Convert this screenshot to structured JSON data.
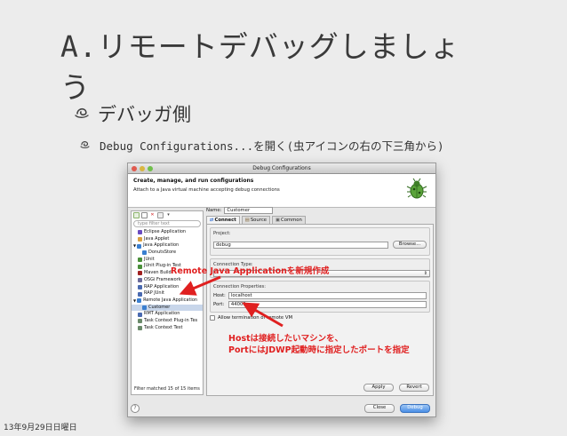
{
  "slide": {
    "title": "A.リモートデバッグしましょう",
    "bullet1": "デバッガ側",
    "bullet2": "Debug Configurations...を開く(虫アイコンの右の下三角から)",
    "date": "13年9月29日日曜日"
  },
  "dialog": {
    "window_title": "Debug Configurations",
    "header_title": "Create, manage, and run configurations",
    "header_desc": "Attach to a Java virtual machine accepting debug connections",
    "filter_placeholder": "type filter text",
    "tree": [
      {
        "label": "Eclipse Application",
        "indent": 1,
        "color": "#6a4bc0"
      },
      {
        "label": "Java Applet",
        "indent": 1,
        "color": "#d9a040"
      },
      {
        "label": "Java Application",
        "indent": 0,
        "color": "#3a7fd0",
        "expanded": true
      },
      {
        "label": "DonutsStore",
        "indent": 2,
        "color": "#3a7fd0"
      },
      {
        "label": "JUnit",
        "indent": 1,
        "color": "#4a8f3a"
      },
      {
        "label": "JUnit Plug-in Test",
        "indent": 1,
        "color": "#4a8f3a"
      },
      {
        "label": "Maven Build",
        "indent": 1,
        "color": "#a02020"
      },
      {
        "label": "OSGi Framework",
        "indent": 1,
        "color": "#6a6a9a"
      },
      {
        "label": "RAP Application",
        "indent": 1,
        "color": "#4a6ab0"
      },
      {
        "label": "RAP JUnit",
        "indent": 1,
        "color": "#4a6ab0"
      },
      {
        "label": "Remote Java Application",
        "indent": 0,
        "color": "#3a7fd0",
        "expanded": true
      },
      {
        "label": "Customer",
        "indent": 2,
        "color": "#3a7fd0",
        "selected": true
      },
      {
        "label": "RMT Application",
        "indent": 1,
        "color": "#4a6ab0"
      },
      {
        "label": "Task Context Plug-in Tes",
        "indent": 1,
        "color": "#6a8a6a"
      },
      {
        "label": "Task Context Test",
        "indent": 1,
        "color": "#6a8a6a"
      }
    ],
    "filter_status": "Filter matched 15 of 15 items",
    "name_label": "Name:",
    "name_value": "Customer",
    "tabs": [
      {
        "label": "Connect",
        "icon": "connect-icon",
        "active": true
      },
      {
        "label": "Source",
        "icon": "source-icon",
        "active": false
      },
      {
        "label": "Common",
        "icon": "common-icon",
        "active": false
      }
    ],
    "project_label": "Project:",
    "project_value": "debug",
    "browse_label": "Browse...",
    "connection_type_label": "Connection Type:",
    "connection_properties_label": "Connection Properties:",
    "host_label": "Host:",
    "host_value": "localhost",
    "port_label": "Port:",
    "port_value": "44000",
    "allow_termination_label": "Allow termination of remote VM",
    "apply_label": "Apply",
    "revert_label": "Revert",
    "close_label": "Close",
    "debug_label": "Debug"
  },
  "annotations": {
    "remote_note": "Remote Java Applicationを新規作成",
    "host_note_line1": "Hostは接続したいマシンを、",
    "host_note_line2": "PortにはJDWP起動時に指定したポートを指定"
  },
  "colors": {
    "annotation_red": "#e02020",
    "selection": "#c8d6ea",
    "default_button": "#4a8fe6"
  }
}
